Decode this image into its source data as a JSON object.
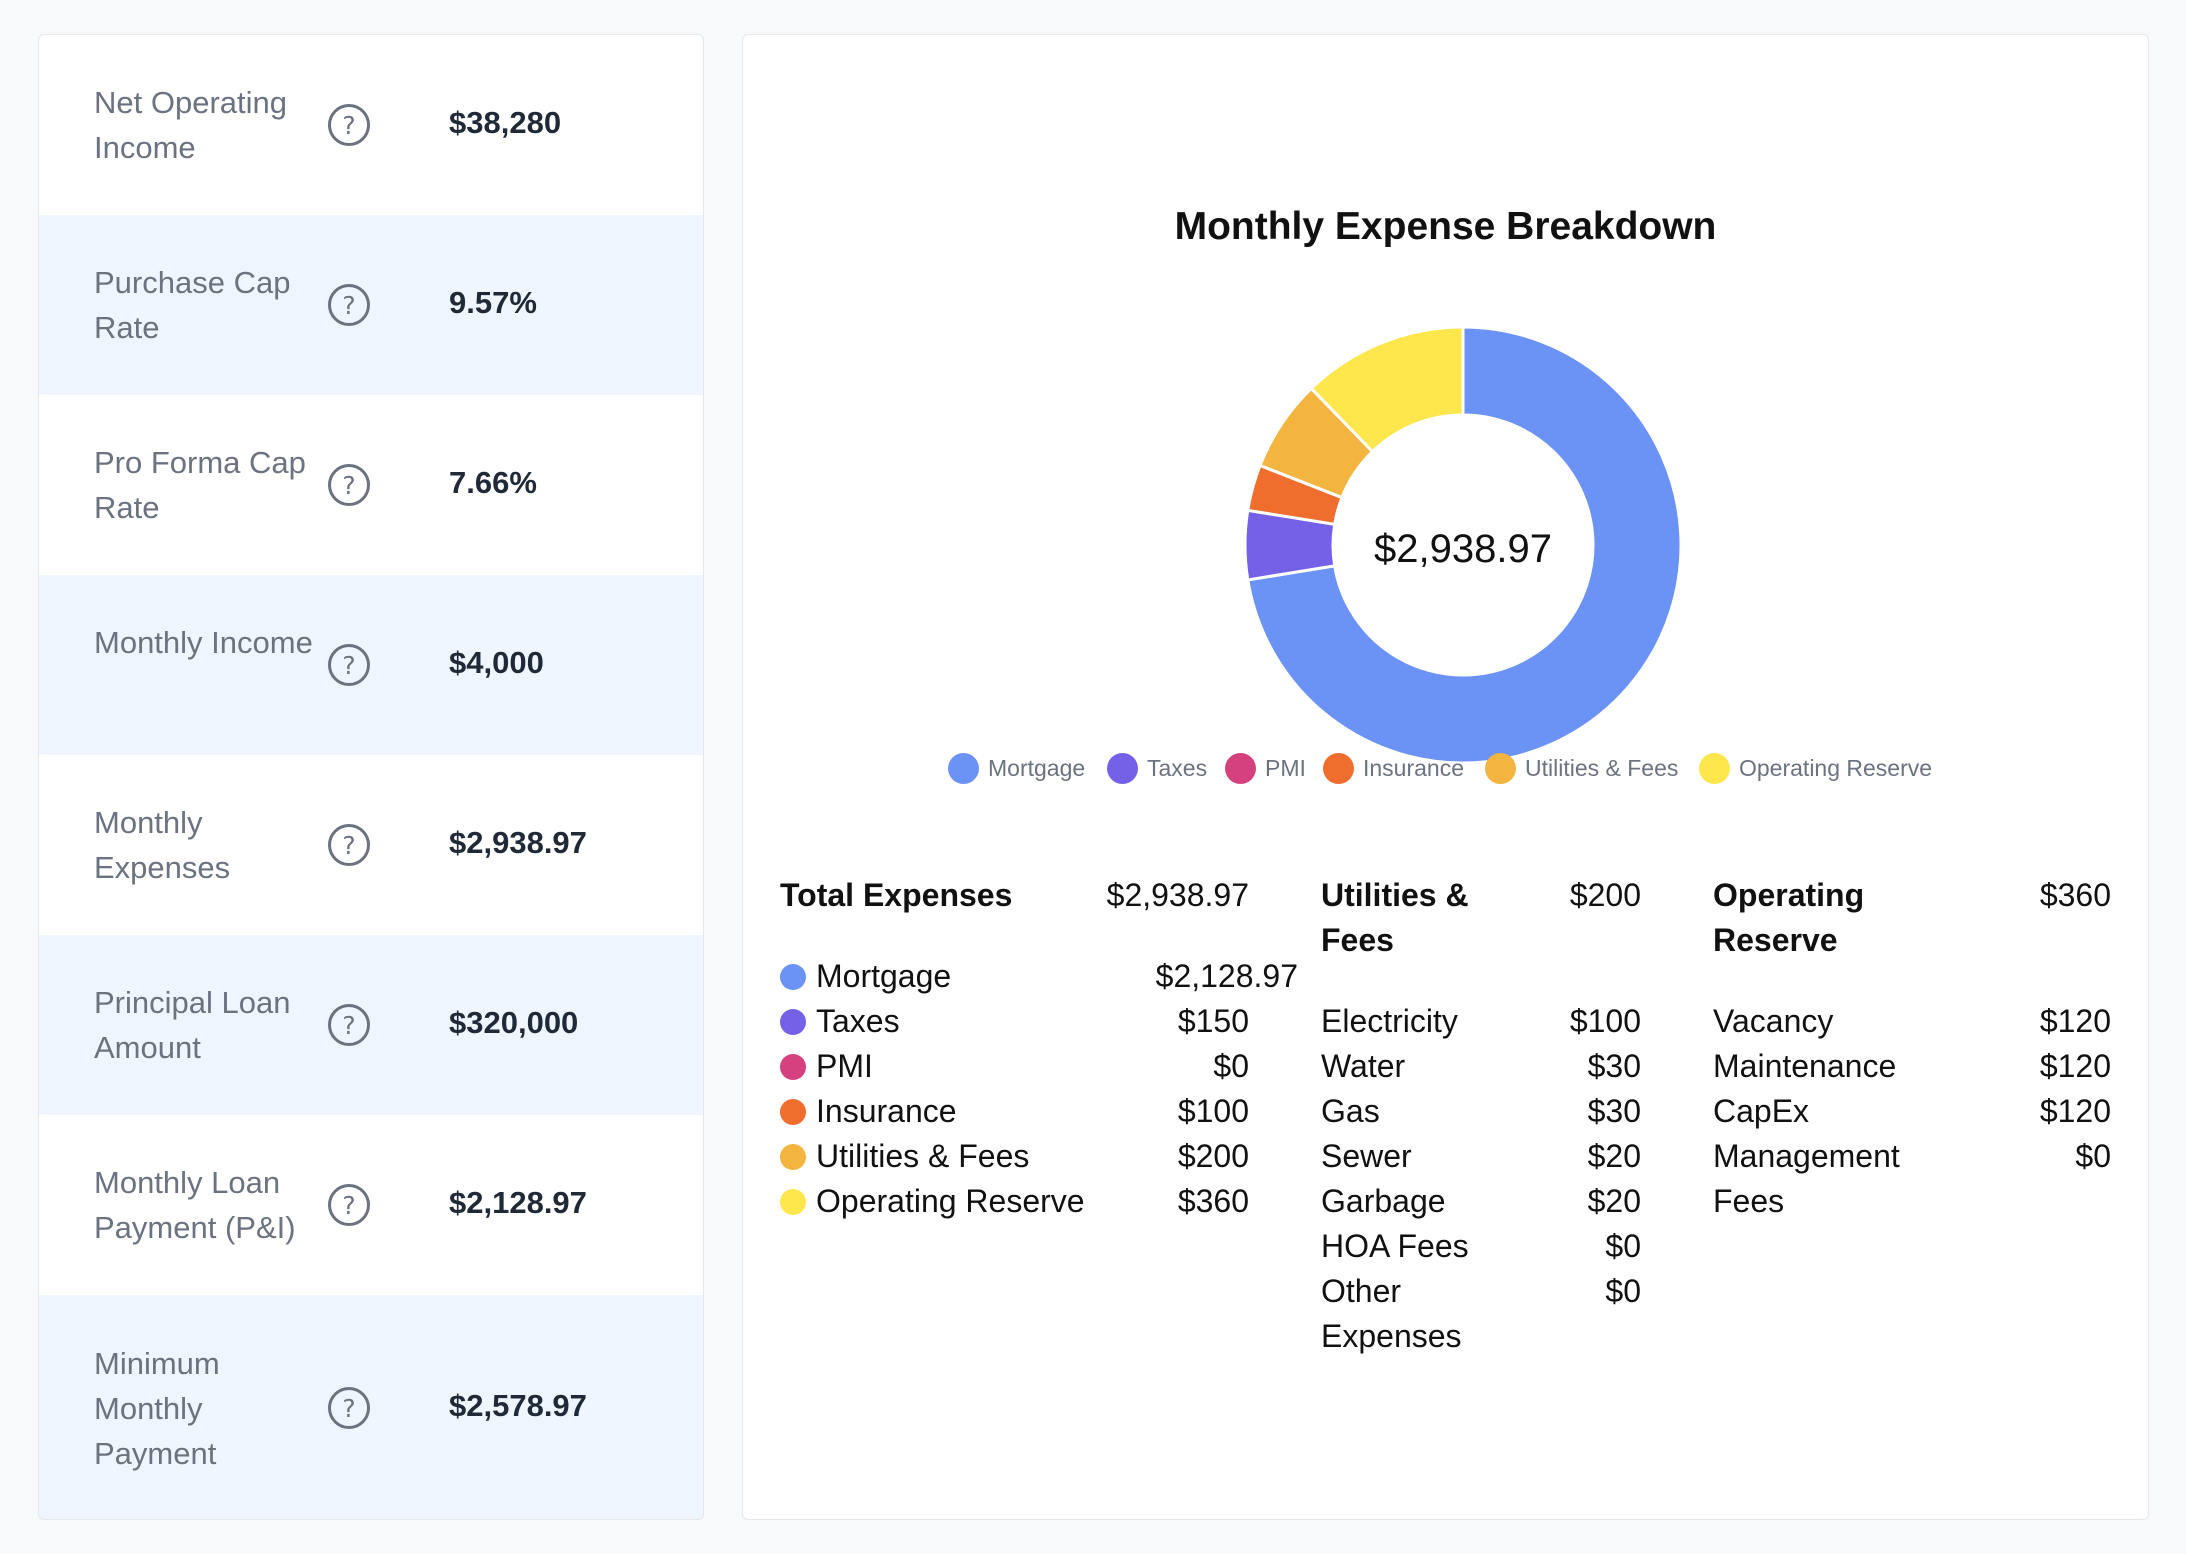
{
  "metrics": [
    {
      "label": "Net Operating Income",
      "value": "$38,280"
    },
    {
      "label": "Purchase Cap Rate",
      "value": "9.57%"
    },
    {
      "label": "Pro Forma Cap Rate",
      "value": "7.66%"
    },
    {
      "label": "Monthly Income",
      "value": "$4,000"
    },
    {
      "label": "Monthly Expenses",
      "value": "$2,938.97"
    },
    {
      "label": "Principal Loan Amount",
      "value": "$320,000"
    },
    {
      "label": "Monthly Loan Payment (P&I)",
      "value": "$2,128.97"
    },
    {
      "label": "Minimum Monthly Payment",
      "value": "$2,578.97"
    }
  ],
  "help_icon": "question-circle-icon",
  "chart_data": {
    "type": "pie",
    "title": "Monthly Expense Breakdown",
    "center_label": "$2,938.97",
    "categories": [
      "Mortgage",
      "Taxes",
      "PMI",
      "Insurance",
      "Utilities & Fees",
      "Operating Reserve"
    ],
    "values": [
      2128.97,
      150,
      0,
      100,
      200,
      360
    ],
    "colors": [
      "#6b93f5",
      "#7561e8",
      "#d5417f",
      "#ef6d2d",
      "#f4b540",
      "#fde74c"
    ],
    "legend": "bottom"
  },
  "summary": {
    "total": {
      "title": "Total Expenses",
      "value": "$2,938.97"
    },
    "breakdown": [
      {
        "label": "Mortgage",
        "value": "$2,128.97"
      },
      {
        "label": "Taxes",
        "value": "$150"
      },
      {
        "label": "PMI",
        "value": "$0"
      },
      {
        "label": "Insurance",
        "value": "$100"
      },
      {
        "label": "Utilities & Fees",
        "value": "$200"
      },
      {
        "label": "Operating Reserve",
        "value": "$360"
      }
    ],
    "utilities": {
      "title": "Utilities & Fees",
      "value": "$200",
      "items": [
        {
          "label": "Electricity",
          "value": "$100"
        },
        {
          "label": "Water",
          "value": "$30"
        },
        {
          "label": "Gas",
          "value": "$30"
        },
        {
          "label": "Sewer",
          "value": "$20"
        },
        {
          "label": "Garbage",
          "value": "$20"
        },
        {
          "label": "HOA Fees",
          "value": "$0"
        },
        {
          "label": "Other Expenses",
          "value": "$0"
        }
      ]
    },
    "reserve": {
      "title": "Operating Reserve",
      "value": "$360",
      "items": [
        {
          "label": "Vacancy",
          "value": "$120"
        },
        {
          "label": "Maintenance",
          "value": "$120"
        },
        {
          "label": "CapEx",
          "value": "$120"
        },
        {
          "label": "Management Fees",
          "value": "$0"
        }
      ]
    }
  }
}
